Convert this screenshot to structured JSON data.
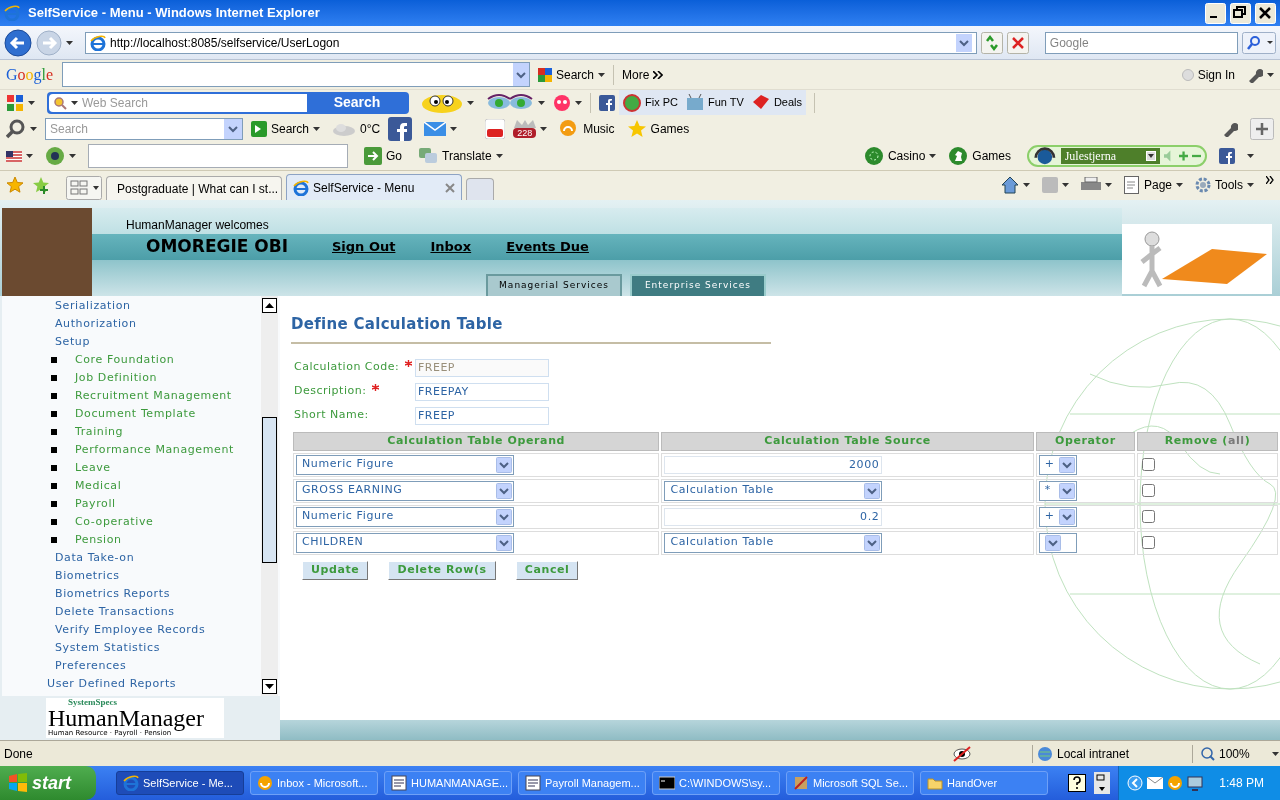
{
  "window": {
    "title": "SelfService - Menu - Windows Internet Explorer"
  },
  "address_bar": {
    "url": "http://localhost:8085/selfservice/UserLogon",
    "search_placeholder": "Google"
  },
  "google_toolbar": {
    "logo": "Google",
    "search_button": "Search",
    "more": "More",
    "sign_in": "Sign In"
  },
  "web_search_toolbar": {
    "placeholder": "Web Search",
    "button": "Search",
    "links": [
      "Fix PC",
      "Fun TV",
      "Deals"
    ]
  },
  "search_toolbar": {
    "placeholder": "Search",
    "search_button": "Search",
    "weather": "0°C",
    "badge": "228",
    "links": [
      "Music",
      "Games"
    ]
  },
  "translate_toolbar": {
    "go": "Go",
    "translate": "Translate",
    "casino": "Casino",
    "games": "Games",
    "radio_station": "Julestjerna"
  },
  "tabs": [
    {
      "label": "Postgraduate | What can I st...",
      "selected": false
    },
    {
      "label": "SelfService - Menu",
      "selected": true
    }
  ],
  "command_bar": {
    "page": "Page",
    "tools": "Tools"
  },
  "header": {
    "welcome": "HumanManager welcomes",
    "user": "OMOREGIE OBI",
    "links": [
      "Sign Out",
      "Inbox",
      "Events Due"
    ],
    "service_tabs": [
      {
        "label": "Managerial Services",
        "selected": false
      },
      {
        "label": "Enterprise Services",
        "selected": true
      }
    ]
  },
  "sidebar": {
    "items": [
      {
        "children": [
          {
            "label": "Serialization"
          },
          {
            "label": "Authorization"
          },
          {
            "label": "Setup",
            "children": [
              {
                "label": "Core Foundation"
              },
              {
                "label": "Job Definition"
              },
              {
                "label": "Recruitment Management"
              },
              {
                "label": "Document Template"
              },
              {
                "label": "Training"
              },
              {
                "label": "Performance Management"
              },
              {
                "label": "Leave"
              },
              {
                "label": "Medical"
              },
              {
                "label": "Payroll"
              },
              {
                "label": "Co-operative"
              },
              {
                "label": "Pension"
              }
            ]
          },
          {
            "label": "Data Take-on"
          },
          {
            "label": "Biometrics"
          },
          {
            "label": "Biometrics Reports"
          },
          {
            "label": "Delete Transactions"
          },
          {
            "label": "Verify Employee Records"
          },
          {
            "label": "System Statistics"
          },
          {
            "label": "Preferences"
          }
        ]
      },
      {
        "label": "User Defined Reports"
      }
    ],
    "logo": {
      "brand": "SystemSpecs",
      "name": "HumanManager",
      "tagline": "Human Resource · Payroll · Pension"
    }
  },
  "form": {
    "title": "Define Calculation Table",
    "fields": [
      {
        "label": "Calculation Code:",
        "required": true,
        "value": "FREEP",
        "disabled": true
      },
      {
        "label": "Description:",
        "required": true,
        "value": "FREEPAY",
        "disabled": false
      },
      {
        "label": "Short Name:",
        "required": false,
        "value": "FREEP",
        "disabled": false
      }
    ],
    "table": {
      "columns": [
        "Calculation Table Operand",
        "Calculation Table Source",
        "Operator"
      ],
      "remove_column": {
        "before": "Remove (",
        "link": "all",
        "after": ")"
      },
      "rows": [
        {
          "operand": "Numeric Figure",
          "kind": "input",
          "source": "2000",
          "operator": "+",
          "remove": false
        },
        {
          "operand": "GROSS EARNING",
          "kind": "select",
          "source": "Calculation Table",
          "operator": "*",
          "remove": false
        },
        {
          "operand": "Numeric Figure",
          "kind": "input",
          "source": "0.2",
          "operator": "+",
          "remove": false
        },
        {
          "operand": "CHILDREN",
          "kind": "select",
          "source": "Calculation Table",
          "remove": false
        }
      ]
    },
    "buttons": [
      "Update",
      "Delete Row(s",
      "Cancel"
    ]
  },
  "status_bar": {
    "text": "Done",
    "zone": "Local intranet",
    "zoom": "100%"
  },
  "taskbar": {
    "start": "start",
    "items": [
      {
        "label": "SelfService - Me...",
        "selected": true,
        "kind": "ie"
      },
      {
        "label": "Inbox - Microsoft...",
        "selected": false,
        "kind": "mail"
      },
      {
        "label": "HUMANMANAGE...",
        "selected": false,
        "kind": "doc"
      },
      {
        "label": "Payroll Managem...",
        "selected": false,
        "kind": "doc"
      },
      {
        "label": "C:\\WINDOWS\\sy...",
        "selected": false,
        "kind": "console"
      },
      {
        "label": "Microsoft SQL Se...",
        "selected": false,
        "kind": "sql"
      },
      {
        "label": "HandOver",
        "selected": false,
        "kind": "folder"
      }
    ],
    "clock": "1:48 PM"
  }
}
